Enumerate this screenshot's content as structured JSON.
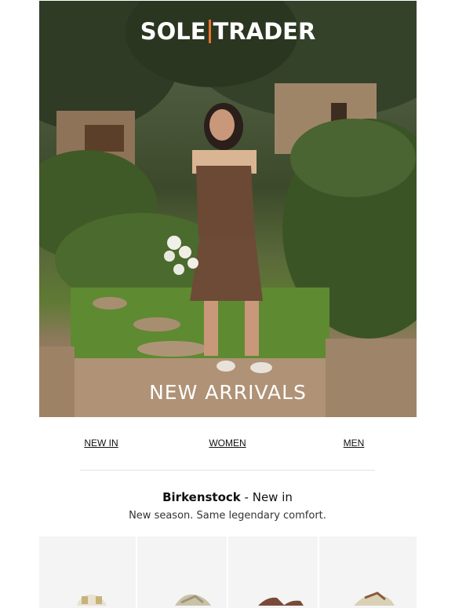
{
  "brand": {
    "logo_left": "SOLE",
    "logo_right": "TRADER",
    "accent_color": "#e8742a"
  },
  "hero": {
    "caption": "NEW ARRIVALS"
  },
  "nav": {
    "items": [
      "NEW IN",
      "WOMEN",
      "MEN"
    ]
  },
  "section": {
    "brand": "Birkenstock",
    "suffix": " - New in",
    "subtitle": "New season. Same legendary comfort."
  },
  "products": [
    {
      "icon": "sandal-icon",
      "color": "#e9e2cf"
    },
    {
      "icon": "sandal-icon",
      "color": "#c9c2a8"
    },
    {
      "icon": "sandal-icon",
      "color": "#7a4a38"
    },
    {
      "icon": "sandal-icon",
      "color": "#d9d1b6"
    }
  ]
}
